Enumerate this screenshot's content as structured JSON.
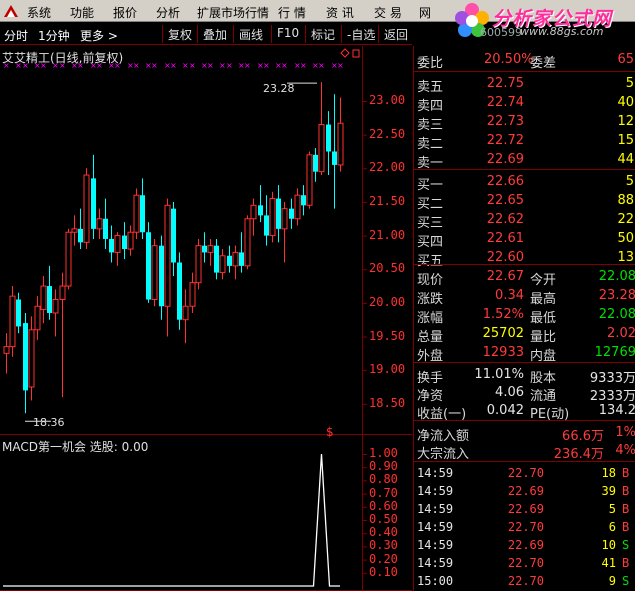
{
  "menu": {
    "items": [
      "系统",
      "功能",
      "报价",
      "分析",
      "扩展市场行情",
      "行 情",
      "资 讯",
      "交 易",
      "网"
    ]
  },
  "brand": {
    "name": "分析家公式网",
    "url": "www.88gs.com",
    "code_partial": "600599"
  },
  "toolbar": {
    "left": [
      "分时",
      "1分钟",
      "更多 >"
    ],
    "buttons": [
      "复权",
      "叠加",
      "画线",
      "F10",
      "标记",
      "-自选",
      "返回"
    ]
  },
  "chart": {
    "title": "艾艾精工(日线,前复权)",
    "high_label": "23.28",
    "low_label": "18.36",
    "y_ticks": [
      "23.00",
      "22.50",
      "22.00",
      "21.50",
      "21.00",
      "20.50",
      "20.00",
      "19.50",
      "19.00",
      "18.50"
    ],
    "macd_title": "MACD第一机会 选股: 0.00",
    "macd_ticks": [
      "1.00",
      "0.90",
      "0.80",
      "0.70",
      "0.60",
      "0.50",
      "0.40",
      "0.30",
      "0.20",
      "0.10"
    ],
    "colors": {
      "up": "#ff3030",
      "down": "#00ffff",
      "axis": "#800000",
      "marker": "#ff00ff"
    }
  },
  "chart_data": {
    "type": "candlestick",
    "y_range": [
      18.2,
      23.55
    ],
    "candles": [
      {
        "o": 19.25,
        "h": 19.55,
        "l": 18.95,
        "c": 19.35
      },
      {
        "o": 19.35,
        "h": 20.25,
        "l": 19.2,
        "c": 20.1
      },
      {
        "o": 20.05,
        "h": 20.15,
        "l": 19.55,
        "c": 19.65
      },
      {
        "o": 19.7,
        "h": 19.85,
        "l": 18.36,
        "c": 18.7
      },
      {
        "o": 18.75,
        "h": 19.8,
        "l": 18.55,
        "c": 19.6
      },
      {
        "o": 19.6,
        "h": 20.1,
        "l": 19.45,
        "c": 19.95
      },
      {
        "o": 19.9,
        "h": 20.4,
        "l": 19.7,
        "c": 20.25
      },
      {
        "o": 20.25,
        "h": 20.55,
        "l": 19.75,
        "c": 19.85
      },
      {
        "o": 19.85,
        "h": 20.2,
        "l": 19.5,
        "c": 20.05
      },
      {
        "o": 20.05,
        "h": 20.45,
        "l": 18.6,
        "c": 20.25
      },
      {
        "o": 20.25,
        "h": 21.1,
        "l": 20.2,
        "c": 21.05
      },
      {
        "o": 21.05,
        "h": 21.3,
        "l": 20.85,
        "c": 21.1
      },
      {
        "o": 21.1,
        "h": 21.4,
        "l": 20.8,
        "c": 20.9
      },
      {
        "o": 20.9,
        "h": 22.0,
        "l": 20.8,
        "c": 21.9
      },
      {
        "o": 21.85,
        "h": 22.2,
        "l": 20.95,
        "c": 21.1
      },
      {
        "o": 21.1,
        "h": 21.4,
        "l": 20.95,
        "c": 21.25
      },
      {
        "o": 21.25,
        "h": 21.55,
        "l": 20.8,
        "c": 20.95
      },
      {
        "o": 20.95,
        "h": 21.15,
        "l": 20.6,
        "c": 20.75
      },
      {
        "o": 20.75,
        "h": 21.05,
        "l": 20.55,
        "c": 21.0
      },
      {
        "o": 21.0,
        "h": 21.2,
        "l": 20.65,
        "c": 20.8
      },
      {
        "o": 20.8,
        "h": 21.15,
        "l": 20.7,
        "c": 21.05
      },
      {
        "o": 21.05,
        "h": 21.7,
        "l": 20.95,
        "c": 21.6
      },
      {
        "o": 21.6,
        "h": 21.85,
        "l": 20.95,
        "c": 21.05
      },
      {
        "o": 21.05,
        "h": 21.2,
        "l": 20.0,
        "c": 20.05
      },
      {
        "o": 20.05,
        "h": 20.95,
        "l": 19.95,
        "c": 20.85
      },
      {
        "o": 20.85,
        "h": 21.0,
        "l": 19.75,
        "c": 19.95
      },
      {
        "o": 19.95,
        "h": 21.55,
        "l": 19.5,
        "c": 21.45
      },
      {
        "o": 21.4,
        "h": 21.5,
        "l": 20.4,
        "c": 20.6
      },
      {
        "o": 20.6,
        "h": 20.75,
        "l": 19.6,
        "c": 19.75
      },
      {
        "o": 19.75,
        "h": 20.2,
        "l": 19.4,
        "c": 19.95
      },
      {
        "o": 19.95,
        "h": 20.45,
        "l": 19.85,
        "c": 20.3
      },
      {
        "o": 20.3,
        "h": 20.95,
        "l": 20.2,
        "c": 20.85
      },
      {
        "o": 20.85,
        "h": 21.05,
        "l": 20.6,
        "c": 20.75
      },
      {
        "o": 20.75,
        "h": 20.95,
        "l": 20.55,
        "c": 20.85
      },
      {
        "o": 20.85,
        "h": 20.95,
        "l": 20.35,
        "c": 20.45
      },
      {
        "o": 20.45,
        "h": 20.8,
        "l": 20.35,
        "c": 20.7
      },
      {
        "o": 20.7,
        "h": 20.85,
        "l": 20.45,
        "c": 20.55
      },
      {
        "o": 20.55,
        "h": 20.85,
        "l": 20.35,
        "c": 20.75
      },
      {
        "o": 20.75,
        "h": 21.05,
        "l": 20.45,
        "c": 20.55
      },
      {
        "o": 20.55,
        "h": 21.3,
        "l": 20.5,
        "c": 21.25
      },
      {
        "o": 21.25,
        "h": 21.55,
        "l": 21.0,
        "c": 21.45
      },
      {
        "o": 21.45,
        "h": 21.75,
        "l": 21.2,
        "c": 21.3
      },
      {
        "o": 21.3,
        "h": 21.6,
        "l": 20.85,
        "c": 21.0
      },
      {
        "o": 21.0,
        "h": 21.65,
        "l": 20.9,
        "c": 21.55
      },
      {
        "o": 21.55,
        "h": 21.75,
        "l": 20.9,
        "c": 21.1
      },
      {
        "o": 21.1,
        "h": 21.5,
        "l": 20.6,
        "c": 21.4
      },
      {
        "o": 21.4,
        "h": 21.55,
        "l": 21.1,
        "c": 21.25
      },
      {
        "o": 21.25,
        "h": 21.7,
        "l": 21.15,
        "c": 21.6
      },
      {
        "o": 21.6,
        "h": 21.75,
        "l": 21.3,
        "c": 21.45
      },
      {
        "o": 21.45,
        "h": 22.25,
        "l": 21.4,
        "c": 22.2
      },
      {
        "o": 22.2,
        "h": 22.3,
        "l": 21.8,
        "c": 21.95
      },
      {
        "o": 21.95,
        "h": 23.28,
        "l": 21.9,
        "c": 22.65
      },
      {
        "o": 22.65,
        "h": 22.85,
        "l": 21.9,
        "c": 22.25
      },
      {
        "o": 22.25,
        "h": 23.1,
        "l": 21.4,
        "c": 22.05
      },
      {
        "o": 22.05,
        "h": 23.05,
        "l": 21.95,
        "c": 22.67
      }
    ],
    "macd": {
      "signal_index": 51,
      "signal_value": 1.0,
      "y_range": [
        0,
        1.0
      ]
    }
  },
  "quote": {
    "weibi": {
      "label": "委比",
      "value": "20.50%",
      "label2": "委差",
      "value2": "65"
    },
    "sell": [
      {
        "label": "卖五",
        "price": "22.75",
        "vol": "5"
      },
      {
        "label": "卖四",
        "price": "22.74",
        "vol": "40"
      },
      {
        "label": "卖三",
        "price": "22.73",
        "vol": "12"
      },
      {
        "label": "卖二",
        "price": "22.72",
        "vol": "15"
      },
      {
        "label": "卖一",
        "price": "22.69",
        "vol": "44"
      }
    ],
    "buy": [
      {
        "label": "买一",
        "price": "22.66",
        "vol": "5"
      },
      {
        "label": "买二",
        "price": "22.65",
        "vol": "88"
      },
      {
        "label": "买三",
        "price": "22.62",
        "vol": "22"
      },
      {
        "label": "买四",
        "price": "22.61",
        "vol": "50"
      },
      {
        "label": "买五",
        "price": "22.60",
        "vol": "13"
      }
    ],
    "stats": [
      {
        "l1": "现价",
        "v1": "22.67",
        "c1": "red",
        "l2": "今开",
        "v2": "22.08",
        "c2": "green"
      },
      {
        "l1": "涨跌",
        "v1": "0.34",
        "c1": "red",
        "l2": "最高",
        "v2": "23.28",
        "c2": "red"
      },
      {
        "l1": "涨幅",
        "v1": "1.52%",
        "c1": "red",
        "l2": "最低",
        "v2": "22.08",
        "c2": "green"
      },
      {
        "l1": "总量",
        "v1": "25702",
        "c1": "yellow",
        "l2": "量比",
        "v2": "2.02",
        "c2": "red"
      },
      {
        "l1": "外盘",
        "v1": "12933",
        "c1": "red",
        "l2": "内盘",
        "v2": "12769",
        "c2": "green"
      }
    ],
    "fund": [
      {
        "l1": "换手",
        "v1": "11.01%",
        "l2": "股本",
        "v2": "9333万"
      },
      {
        "l1": "净资",
        "v1": "4.06",
        "l2": "流通",
        "v2": "2333万"
      },
      {
        "l1": "收益(一)",
        "v1": "0.042",
        "l2": "PE(动)",
        "v2": "134.2"
      }
    ],
    "flow": [
      {
        "label": "净流入额",
        "value": "66.6万",
        "pct": "1%"
      },
      {
        "label": "大宗流入",
        "value": "236.4万",
        "pct": "4%"
      }
    ],
    "ticks": [
      {
        "time": "14:59",
        "price": "22.70",
        "vol": "18",
        "side": "B"
      },
      {
        "time": "14:59",
        "price": "22.69",
        "vol": "39",
        "side": "B"
      },
      {
        "time": "14:59",
        "price": "22.69",
        "vol": "5",
        "side": "B"
      },
      {
        "time": "14:59",
        "price": "22.70",
        "vol": "6",
        "side": "B"
      },
      {
        "time": "14:59",
        "price": "22.69",
        "vol": "10",
        "side": "S"
      },
      {
        "time": "14:59",
        "price": "22.70",
        "vol": "41",
        "side": "B"
      },
      {
        "time": "15:00",
        "price": "22.70",
        "vol": "9",
        "side": "S"
      }
    ]
  }
}
